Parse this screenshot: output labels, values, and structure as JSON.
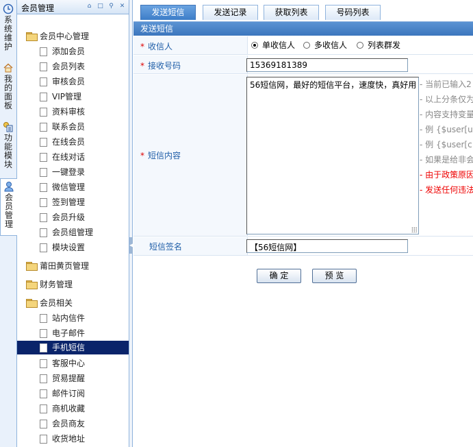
{
  "vertical_tabs": [
    {
      "label": "系统维护",
      "icon": "clock-icon"
    },
    {
      "label": "我的面板",
      "icon": "home-icon"
    },
    {
      "label": "功能模块",
      "icon": "module-icon"
    },
    {
      "label": "会员管理",
      "icon": "user-icon",
      "active": true
    }
  ],
  "panel": {
    "title": "会员管理",
    "buttons": [
      "home-icon",
      "restore-icon",
      "search-icon",
      "close-icon"
    ]
  },
  "tree": {
    "groups": [
      "会员中心管理",
      "莆田黄页管理",
      "财务管理",
      "会员相关"
    ],
    "member_center_items": [
      "添加会员",
      "会员列表",
      "审核会员",
      "VIP管理",
      "资料审核",
      "联系会员",
      "在线会员",
      "在线对话",
      "一键登录",
      "微信管理",
      "签到管理",
      "会员升级",
      "会员组管理",
      "模块设置"
    ],
    "member_related_items": [
      "站内信件",
      "电子邮件",
      "手机短信",
      "客服中心",
      "贸易提醒",
      "邮件订阅",
      "商机收藏",
      "会员商友",
      "收货地址"
    ],
    "selected": "手机短信"
  },
  "tabs": [
    "发送短信",
    "发送记录",
    "获取列表",
    "号码列表"
  ],
  "active_tab": "发送短信",
  "section_title": "发送短信",
  "form": {
    "recipient_label": "收信人",
    "recipient_options": [
      "单收信人",
      "多收信人",
      "列表群发"
    ],
    "recipient_selected": "单收信人",
    "number_label": "接收号码",
    "number_value": "15369181389",
    "content_label": "短信内容",
    "content_value": "56短信网，最好的短信平台，速度快，真好用",
    "signature_label": "短信签名",
    "signature_value": "【56短信网】"
  },
  "hints": [
    {
      "text": "- 当前已输入2",
      "color": "gray"
    },
    {
      "text": "- 以上分条仅为",
      "color": "gray"
    },
    {
      "text": "- 内容支持变量",
      "color": "gray"
    },
    {
      "text": "- 例 {$user[u",
      "color": "gray"
    },
    {
      "text": "- 例 {$user[c",
      "color": "gray"
    },
    {
      "text": "- 如果是给非会",
      "color": "gray"
    },
    {
      "text": "- 由于政策原因",
      "color": "red"
    },
    {
      "text": "- 发送任何违法",
      "color": "red"
    }
  ],
  "buttons": {
    "confirm": "确 定",
    "preview": "预 览"
  },
  "colors": {
    "accent": "#3d7dc8",
    "selection": "#0a246a",
    "label": "#1f5ea8",
    "required": "#dd0000"
  }
}
